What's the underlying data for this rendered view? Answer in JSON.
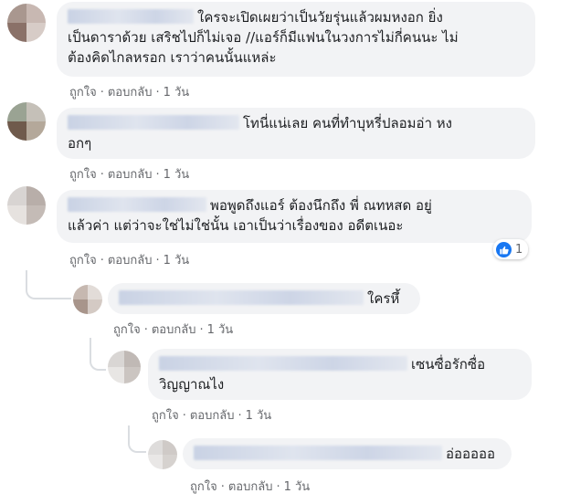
{
  "comments": [
    {
      "text_lines": [
        "ใครจะเปิดเผยว่าเป็นวัยรุ่นแล้วผมหงอก ยิ่ง",
        "เป็นดาราด้วย เสริชไปก็ไม่เจอ //แอร์ก็มีแฟนในวงการไม่กี่คนนะ ไม่",
        "ต้องคิดไกลหรอก เราว่าคนนั้นแหล่ะ"
      ],
      "like": "ถูกใจ",
      "reply": "ตอบกลับ",
      "time": "1 วัน",
      "avatar_colors": [
        "#a9978f",
        "#c8b8b2",
        "#8a7168",
        "#d7ccc7"
      ]
    },
    {
      "text_lines": [
        "โทนี่แน่เลย คนที่ทำบุหรี่ปลอมอ่า หง",
        "อกๆ"
      ],
      "like": "ถูกใจ",
      "reply": "ตอบกลับ",
      "time": "1 วัน",
      "avatar_colors": [
        "#9aa393",
        "#c5c0b8",
        "#6f5a4c",
        "#b4a89a"
      ]
    },
    {
      "text_lines": [
        "พอพูดถึงแอร์ ต้องนึกถึง พี่ ณทหสด อยู่",
        "แล้วค่า แต่ว่าจะใช่ไม่ใช่นั้น เอาเป็นว่าเรื่องของ อดีตเนอะ"
      ],
      "like": "ถูกใจ",
      "reply": "ตอบกลับ",
      "time": "1 วัน",
      "reaction_count": "1",
      "avatar_colors": [
        "#d8d4d2",
        "#b8aea9",
        "#e6e2df",
        "#c4bbb6"
      ]
    },
    {
      "text_lines": [
        "ใครหึ้"
      ],
      "like": "ถูกใจ",
      "reply": "ตอบกลับ",
      "time": "1 วัน",
      "avatar_colors": [
        "#c6b8b0",
        "#e2dcd8",
        "#a8958b",
        "#d4cac4"
      ]
    },
    {
      "text_lines": [
        "เซนซื่อรักซื่อ",
        "วิญญาณไง"
      ],
      "like": "ถูกใจ",
      "reply": "ตอบกลับ",
      "time": "1 วัน",
      "avatar_colors": [
        "#d9d6d4",
        "#c0b9b5",
        "#e8e6e4",
        "#cbc5c1"
      ]
    },
    {
      "text_lines": [
        "อ่อออออ"
      ],
      "like": "ถูกใจ",
      "reply": "ตอบกลับ",
      "time": "1 วัน",
      "avatar_colors": [
        "#dedcdb",
        "#cfcac7",
        "#e9e7e6",
        "#d6d2cf"
      ]
    }
  ],
  "colors": {
    "bubble": "#f2f3f5",
    "meta": "#65676b",
    "like_blue": "#1877f2"
  },
  "icons": {
    "reaction": "thumbs-up-icon"
  }
}
